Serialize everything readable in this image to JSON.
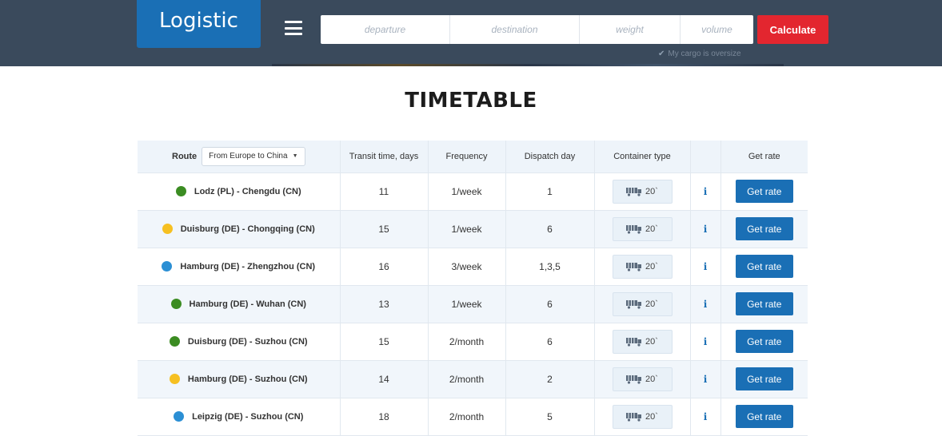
{
  "header": {
    "logo": "Logistic",
    "placeholders": {
      "departure": "departure",
      "destination": "destination",
      "weight": "weight",
      "volume": "volume"
    },
    "calculate_label": "Calculate",
    "oversize_label": "My cargo is oversize",
    "accent": "#1a6fb5",
    "calculate_color": "#e3262f"
  },
  "page_title": "TIMETABLE",
  "table": {
    "headers": {
      "route": "Route",
      "route_filter": "From Europe to China",
      "transit": "Transit time, days",
      "frequency": "Frequency",
      "dispatch": "Dispatch day",
      "container": "Container type",
      "info": "",
      "rate": "Get rate"
    },
    "rows": [
      {
        "route": "Lodz (PL) - Chengdu (CN)",
        "dot_color": "#3b8c22",
        "transit": "11",
        "frequency": "1/week",
        "dispatch": "1",
        "container": "20`",
        "info": "i",
        "rate": "Get rate"
      },
      {
        "route": "Duisburg (DE) - Chongqing (CN)",
        "dot_color": "#f6c021",
        "transit": "15",
        "frequency": "1/week",
        "dispatch": "6",
        "container": "20`",
        "info": "i",
        "rate": "Get rate"
      },
      {
        "route": "Hamburg (DE) - Zhengzhou (CN)",
        "dot_color": "#2b8fd4",
        "transit": "16",
        "frequency": "3/week",
        "dispatch": "1,3,5",
        "container": "20`",
        "info": "i",
        "rate": "Get rate"
      },
      {
        "route": "Hamburg (DE) - Wuhan (CN)",
        "dot_color": "#3b8c22",
        "transit": "13",
        "frequency": "1/week",
        "dispatch": "6",
        "container": "20`",
        "info": "i",
        "rate": "Get rate"
      },
      {
        "route": "Duisburg (DE) - Suzhou (CN)",
        "dot_color": "#3b8c22",
        "transit": "15",
        "frequency": "2/month",
        "dispatch": "6",
        "container": "20`",
        "info": "i",
        "rate": "Get rate"
      },
      {
        "route": "Hamburg (DE) - Suzhou (CN)",
        "dot_color": "#f6c021",
        "transit": "14",
        "frequency": "2/month",
        "dispatch": "2",
        "container": "20`",
        "info": "i",
        "rate": "Get rate"
      },
      {
        "route": "Leipzig (DE) - Suzhou (CN)",
        "dot_color": "#2b8fd4",
        "transit": "18",
        "frequency": "2/month",
        "dispatch": "5",
        "container": "20`",
        "info": "i",
        "rate": "Get rate"
      }
    ]
  }
}
